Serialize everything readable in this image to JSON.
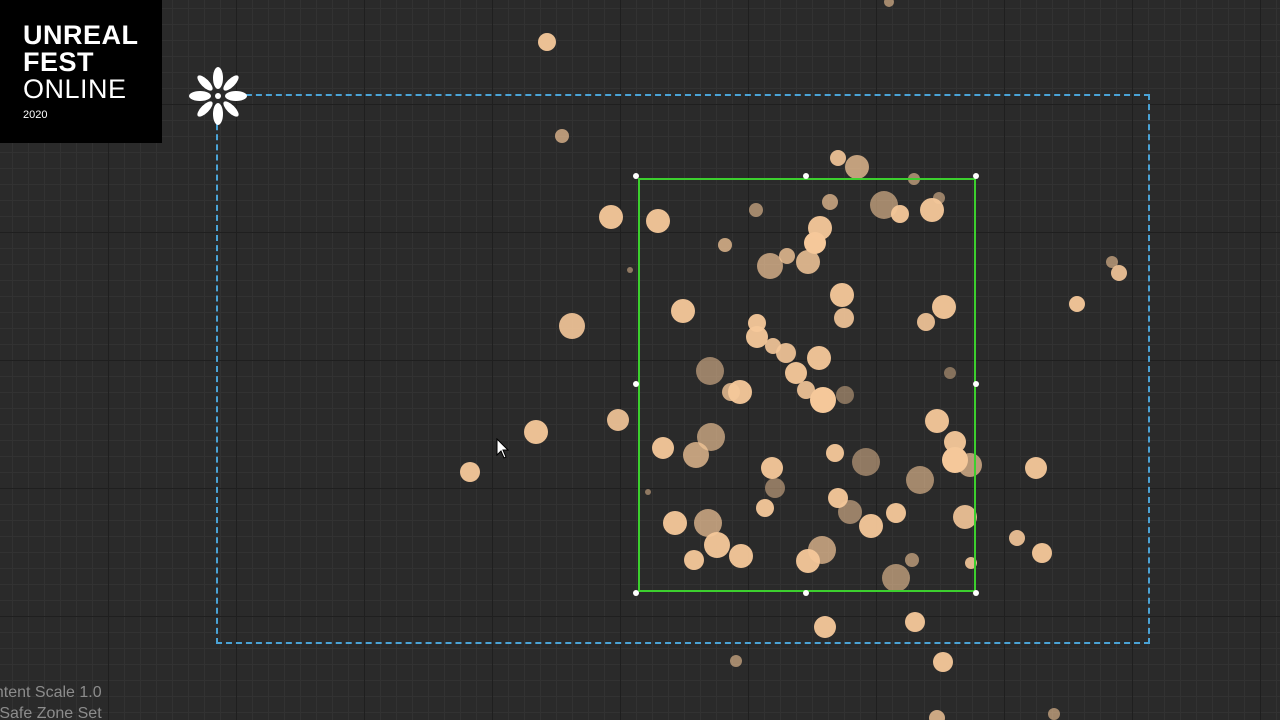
{
  "watermark": {
    "line1": "UNREAL",
    "line2": "FEST",
    "line3": "ONLINE",
    "year": "2020"
  },
  "viewport": {
    "anchor_icon": "anchor-flower-icon",
    "cursor_icon": "mouse-pointer-icon",
    "safe_zone_color": "#4aa3d6",
    "selection_color": "#3ccf2e",
    "particle_color": "#f5c89a"
  },
  "status": {
    "content_scale": "ontent Scale 1.0",
    "safe_zone": "e Safe Zone Set"
  }
}
